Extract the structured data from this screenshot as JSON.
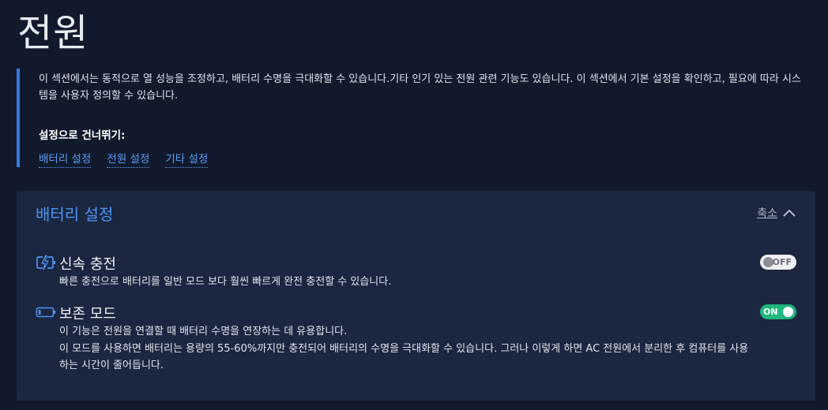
{
  "page": {
    "title": "전원"
  },
  "intro": {
    "text": "이 섹션에서는 동적으로 열 성능을 조정하고, 배터리 수명을 극대화할 수 있습니다.기타 인기 있는 전원 관련 기능도 있습니다. 이 섹션에서 기본 설정을 확인하고, 필요에 따라 시스템을 사용자 정의할 수 있습니다.",
    "skip_heading": "설정으로 건너뛰기:",
    "links": [
      "배터리 설정",
      "전원 설정",
      "기타 설정"
    ]
  },
  "battery_panel": {
    "title": "배터리 설정",
    "collapse_label": "축소",
    "settings": [
      {
        "icon": "rapid-charge-icon",
        "name": "신속 충전",
        "description": "빠른 충전으로 배터리를 일반 모드 보다 훨씬 빠르게 완전 충전할 수 있습니다.",
        "toggle_state": "OFF"
      },
      {
        "icon": "battery-conservation-icon",
        "name": "보존 모드",
        "description_lines": [
          "이 기능은 전원을 연결할 때 배터리 수명을 연장하는 데 유용합니다.",
          "이 모드를 사용하면 배터리는 용량의 55-60%까지만 충전되어 배터리의 수명을 극대화할 수 있습니다. 그러나 이렇게 하면 AC 전원에서 분리한 후 컴퓨터를 사용하는 시간이 줄어듭니다."
        ],
        "toggle_state": "ON"
      }
    ]
  },
  "colors": {
    "background": "#111a2c",
    "panel": "#1b2640",
    "accent": "#4d95f3",
    "toggle_on": "#1fb77c"
  }
}
